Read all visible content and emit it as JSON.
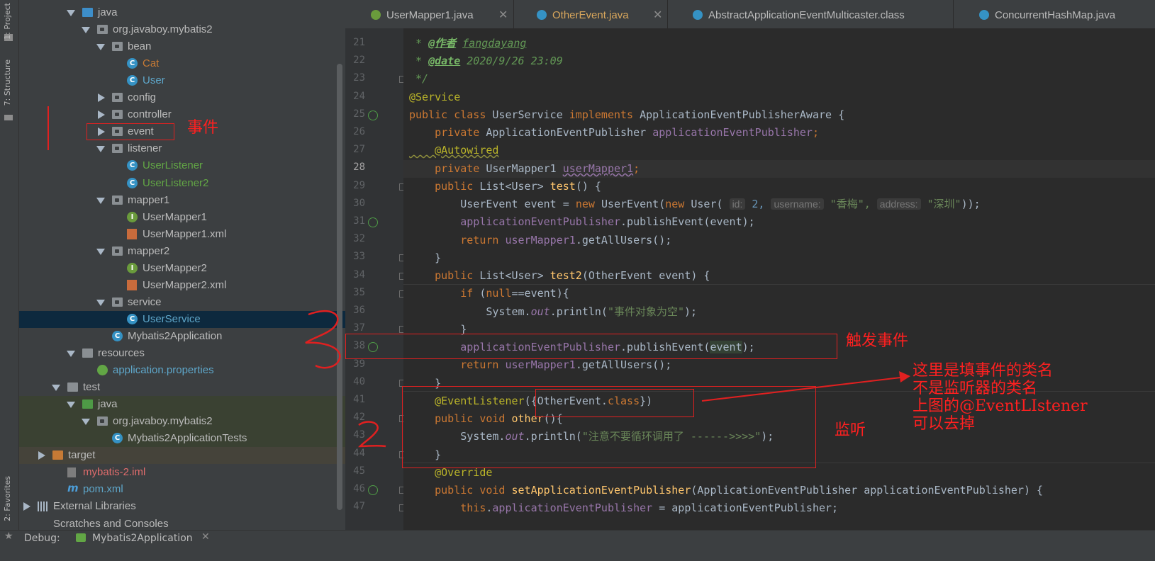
{
  "left_strip": {
    "project_tab": "1: Project",
    "structure_tab": "7: Structure",
    "favorites_tab": "2: Favorites"
  },
  "tree": [
    {
      "label": "java",
      "indent": 3,
      "arrow": "open",
      "icon": "folder-blue",
      "color": ""
    },
    {
      "label": "org.javaboy.mybatis2",
      "indent": 4,
      "arrow": "open",
      "icon": "folder",
      "color": ""
    },
    {
      "label": "bean",
      "indent": 5,
      "arrow": "open",
      "icon": "folder",
      "color": ""
    },
    {
      "label": "Cat",
      "indent": 6,
      "arrow": "",
      "icon": "class",
      "color": "orange"
    },
    {
      "label": "User",
      "indent": 6,
      "arrow": "",
      "icon": "class",
      "color": "teal"
    },
    {
      "label": "config",
      "indent": 5,
      "arrow": "closed",
      "icon": "folder",
      "color": ""
    },
    {
      "label": "controller",
      "indent": 5,
      "arrow": "closed",
      "icon": "folder",
      "color": ""
    },
    {
      "label": "event",
      "indent": 5,
      "arrow": "closed",
      "icon": "folder",
      "color": ""
    },
    {
      "label": "listener",
      "indent": 5,
      "arrow": "open",
      "icon": "folder",
      "color": ""
    },
    {
      "label": "UserListener",
      "indent": 6,
      "arrow": "",
      "icon": "class",
      "color": "green"
    },
    {
      "label": "UserListener2",
      "indent": 6,
      "arrow": "",
      "icon": "class",
      "color": "green"
    },
    {
      "label": "mapper1",
      "indent": 5,
      "arrow": "open",
      "icon": "folder",
      "color": ""
    },
    {
      "label": "UserMapper1",
      "indent": 6,
      "arrow": "",
      "icon": "iface",
      "color": ""
    },
    {
      "label": "UserMapper1.xml",
      "indent": 6,
      "arrow": "",
      "icon": "xml",
      "color": ""
    },
    {
      "label": "mapper2",
      "indent": 5,
      "arrow": "open",
      "icon": "folder",
      "color": ""
    },
    {
      "label": "UserMapper2",
      "indent": 6,
      "arrow": "",
      "icon": "iface",
      "color": ""
    },
    {
      "label": "UserMapper2.xml",
      "indent": 6,
      "arrow": "",
      "icon": "xml",
      "color": ""
    },
    {
      "label": "service",
      "indent": 5,
      "arrow": "open",
      "icon": "folder",
      "color": ""
    },
    {
      "label": "UserService",
      "indent": 6,
      "arrow": "",
      "icon": "class",
      "color": "teal",
      "selected": true
    },
    {
      "label": "Mybatis2Application",
      "indent": 5,
      "arrow": "",
      "icon": "class",
      "color": ""
    },
    {
      "label": "resources",
      "indent": 3,
      "arrow": "open",
      "icon": "folder-grey",
      "color": ""
    },
    {
      "label": "application.properties",
      "indent": 4,
      "arrow": "",
      "icon": "props",
      "color": "blue"
    },
    {
      "label": "test",
      "indent": 2,
      "arrow": "open",
      "icon": "folder-grey",
      "color": ""
    },
    {
      "label": "java",
      "indent": 3,
      "arrow": "open",
      "icon": "folder-green",
      "color": "",
      "test": true
    },
    {
      "label": "org.javaboy.mybatis2",
      "indent": 4,
      "arrow": "open",
      "icon": "folder",
      "color": "",
      "test": true
    },
    {
      "label": "Mybatis2ApplicationTests",
      "indent": 5,
      "arrow": "",
      "icon": "class",
      "color": "",
      "test": true
    },
    {
      "label": "target",
      "indent": 1,
      "arrow": "closed",
      "icon": "folder-orange",
      "color": "",
      "excluded": true
    },
    {
      "label": "mybatis-2.iml",
      "indent": 2,
      "arrow": "",
      "icon": "iml",
      "color": "red"
    },
    {
      "label": "pom.xml",
      "indent": 2,
      "arrow": "",
      "icon": "maven",
      "color": "teal"
    },
    {
      "label": "External Libraries",
      "indent": 0,
      "arrow": "closed",
      "icon": "libs",
      "color": ""
    },
    {
      "label": "Scratches and Consoles",
      "indent": 0,
      "arrow": "",
      "icon": "",
      "color": ""
    }
  ],
  "tabs": [
    {
      "label": "UserMapper1.java",
      "color": "#bbbbbb",
      "icon": "interface-icon"
    },
    {
      "label": "OtherEvent.java",
      "color": "#d9a75c",
      "icon": "class-icon"
    },
    {
      "label": "AbstractApplicationEventMulticaster.class",
      "color": "#bbbbbb",
      "icon": "class-icon"
    },
    {
      "label": "ConcurrentHashMap.java",
      "color": "#bbbbbb",
      "icon": "class-icon"
    }
  ],
  "code": {
    "line_numbers": [
      "21",
      "22",
      "23",
      "24",
      "25",
      "26",
      "27",
      "28",
      "29",
      "30",
      "31",
      "32",
      "33",
      "34",
      "35",
      "36",
      "37",
      "38",
      "39",
      "40",
      "41",
      "42",
      "43",
      "44",
      "45",
      "46",
      "47"
    ],
    "l21": [
      " * ",
      "@作者",
      " ",
      "fangdayang"
    ],
    "l22": [
      " * ",
      "@date",
      " 2020/9/26 23:09"
    ],
    "l23": " */",
    "l24": "@Service",
    "l25": [
      "public class ",
      "UserService ",
      "implements ",
      "ApplicationEventPublisherAware {"
    ],
    "l26": [
      "    private ",
      "ApplicationEventPublisher ",
      "applicationEventPublisher",
      ";"
    ],
    "l27": "    @Autowired",
    "l28": [
      "    private ",
      "UserMapper1 ",
      "userMapper1",
      ";"
    ],
    "l29": [
      "    public ",
      "List<User> ",
      "test",
      "() {"
    ],
    "l30": [
      "        UserEvent event = ",
      "new ",
      "UserEvent(",
      "new ",
      "User( ",
      "id:",
      " 2, ",
      "username:",
      " \"香梅\", ",
      "address:",
      " \"深圳\"",
      "));"
    ],
    "l31": [
      "        ",
      "applicationEventPublisher",
      ".publishEvent(event);"
    ],
    "l32": [
      "        ",
      "return ",
      "userMapper1",
      ".getAllUsers();"
    ],
    "l33": "    }",
    "l34": [
      "    public ",
      "List<User> ",
      "test2",
      "(OtherEvent event) {"
    ],
    "l35": [
      "        ",
      "if ",
      "(",
      "null",
      "==event){"
    ],
    "l36": [
      "            System.",
      "out",
      ".println(",
      "\"事件对象为空\"",
      ");"
    ],
    "l37": "        }",
    "l38": [
      "        ",
      "applicationEventPublisher",
      ".publishEvent(",
      "event",
      ");"
    ],
    "l39": [
      "        ",
      "return ",
      "userMapper1",
      ".getAllUsers();"
    ],
    "l40": "    }",
    "l41": [
      "    @EventListener",
      "({OtherEvent.",
      "class",
      "})"
    ],
    "l42": [
      "    public void ",
      "other",
      "(){"
    ],
    "l43": [
      "        System.",
      "out",
      ".println(",
      "\"注意不要循环调用了 ------>>>>\"",
      ");"
    ],
    "l44": "    }",
    "l45": "    @Override",
    "l46": [
      "    public void ",
      "setApplicationEventPublisher",
      "(ApplicationEventPublisher applicationEventPublisher) {"
    ],
    "l47": [
      "        ",
      "this",
      ".",
      "applicationEventPublisher",
      " = applicationEventPublisher;"
    ]
  },
  "bottom": {
    "debug_label": "Debug:",
    "run_config": "Mybatis2Application"
  },
  "annotations": {
    "event_label": "事件",
    "trigger_label": "触发事件",
    "listen_label": "监听",
    "note_line1": "这里是填事件的类名",
    "note_line2": "不是监听器的类名",
    "note_line3": "上图的@EventLIstener",
    "note_line4": "可以去掉",
    "num_two": "2",
    "num_three": "3"
  },
  "colors": {
    "accent_selected": "#0d293e",
    "annotation": "#ff2020"
  }
}
